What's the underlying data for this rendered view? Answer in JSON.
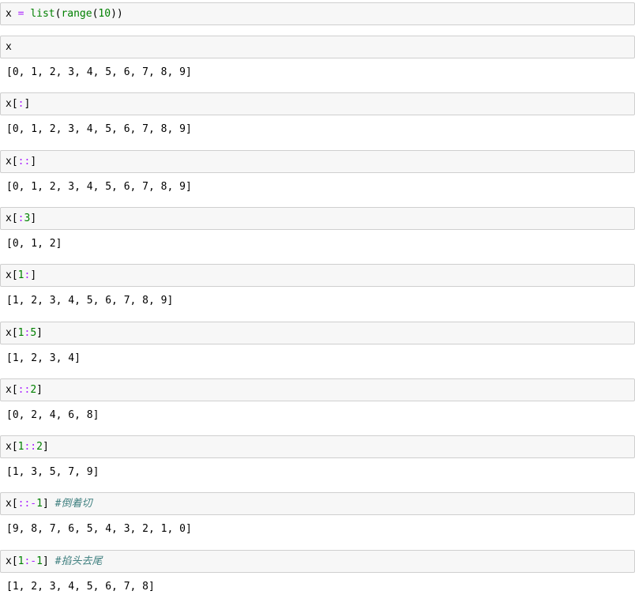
{
  "cells": [
    {
      "input": [
        {
          "t": "x",
          "k": "var"
        },
        {
          "t": " ",
          "k": "var"
        },
        {
          "t": "=",
          "k": "op"
        },
        {
          "t": " ",
          "k": "var"
        },
        {
          "t": "list",
          "k": "builtin"
        },
        {
          "t": "(",
          "k": "var"
        },
        {
          "t": "range",
          "k": "builtin"
        },
        {
          "t": "(",
          "k": "var"
        },
        {
          "t": "10",
          "k": "num"
        },
        {
          "t": "))",
          "k": "var"
        }
      ],
      "output": null
    },
    {
      "input": [
        {
          "t": "x",
          "k": "var"
        }
      ],
      "output": "[0, 1, 2, 3, 4, 5, 6, 7, 8, 9]"
    },
    {
      "input": [
        {
          "t": "x[",
          "k": "var"
        },
        {
          "t": ":",
          "k": "op"
        },
        {
          "t": "]",
          "k": "var"
        }
      ],
      "output": "[0, 1, 2, 3, 4, 5, 6, 7, 8, 9]"
    },
    {
      "input": [
        {
          "t": "x[",
          "k": "var"
        },
        {
          "t": "::",
          "k": "op"
        },
        {
          "t": "]",
          "k": "var"
        }
      ],
      "output": "[0, 1, 2, 3, 4, 5, 6, 7, 8, 9]"
    },
    {
      "input": [
        {
          "t": "x[",
          "k": "var"
        },
        {
          "t": ":",
          "k": "op"
        },
        {
          "t": "3",
          "k": "num"
        },
        {
          "t": "]",
          "k": "var"
        }
      ],
      "output": "[0, 1, 2]"
    },
    {
      "input": [
        {
          "t": "x[",
          "k": "var"
        },
        {
          "t": "1",
          "k": "num"
        },
        {
          "t": ":",
          "k": "op"
        },
        {
          "t": "]",
          "k": "var"
        }
      ],
      "output": "[1, 2, 3, 4, 5, 6, 7, 8, 9]"
    },
    {
      "input": [
        {
          "t": "x[",
          "k": "var"
        },
        {
          "t": "1",
          "k": "num"
        },
        {
          "t": ":",
          "k": "op"
        },
        {
          "t": "5",
          "k": "num"
        },
        {
          "t": "]",
          "k": "var"
        }
      ],
      "output": "[1, 2, 3, 4]"
    },
    {
      "input": [
        {
          "t": "x[",
          "k": "var"
        },
        {
          "t": "::",
          "k": "op"
        },
        {
          "t": "2",
          "k": "num"
        },
        {
          "t": "]",
          "k": "var"
        }
      ],
      "output": "[0, 2, 4, 6, 8]"
    },
    {
      "input": [
        {
          "t": "x[",
          "k": "var"
        },
        {
          "t": "1",
          "k": "num"
        },
        {
          "t": "::",
          "k": "op"
        },
        {
          "t": "2",
          "k": "num"
        },
        {
          "t": "]",
          "k": "var"
        }
      ],
      "output": "[1, 3, 5, 7, 9]"
    },
    {
      "input": [
        {
          "t": "x[",
          "k": "var"
        },
        {
          "t": "::-",
          "k": "op"
        },
        {
          "t": "1",
          "k": "num"
        },
        {
          "t": "] ",
          "k": "var"
        },
        {
          "t": "#倒着切",
          "k": "comment"
        }
      ],
      "output": "[9, 8, 7, 6, 5, 4, 3, 2, 1, 0]"
    },
    {
      "input": [
        {
          "t": "x[",
          "k": "var"
        },
        {
          "t": "1",
          "k": "num"
        },
        {
          "t": ":-",
          "k": "op"
        },
        {
          "t": "1",
          "k": "num"
        },
        {
          "t": "] ",
          "k": "var"
        },
        {
          "t": "#掐头去尾",
          "k": "comment"
        }
      ],
      "output": "[1, 2, 3, 4, 5, 6, 7, 8]"
    }
  ],
  "colors": {
    "cell_background": "#f7f7f7",
    "cell_border": "#cfcfcf",
    "operator": "#aa22ff",
    "builtin": "#008000",
    "number": "#008000",
    "comment": "#408080"
  }
}
